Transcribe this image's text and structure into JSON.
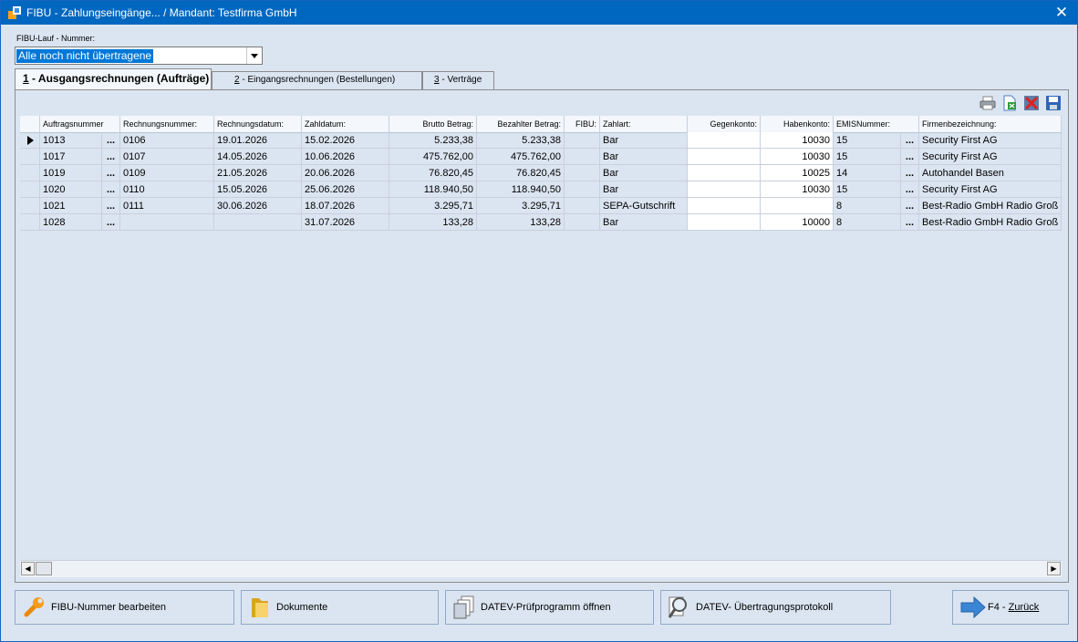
{
  "window": {
    "title": "FIBU - Zahlungseingänge... / Mandant: Testfirma GmbH",
    "close": "✕"
  },
  "fibu_lauf": {
    "label": "FIBU-Lauf - Nummer:",
    "selected": "Alle noch nicht übertragene"
  },
  "tabs": [
    {
      "num": "1",
      "label": " - Ausgangsrechnungen (Aufträge)"
    },
    {
      "num": "2",
      "label": " - Eingangsrechnungen (Bestellungen)"
    },
    {
      "num": "3",
      "label": " - Verträge"
    }
  ],
  "grid": {
    "headers": [
      "Auftragsnummer",
      "Rechnungsnummer:",
      "Rechnungsdatum:",
      "Zahldatum:",
      "Brutto Betrag:",
      "Bezahlter Betrag:",
      "FIBU:",
      "Zahlart:",
      "Gegenkonto:",
      "Habenkonto:",
      "EMISNummer:",
      "Firmenbezeichnung:"
    ],
    "dots": "...",
    "rows": [
      {
        "auftrag": "1013",
        "rechnung": "0106",
        "rdatum": "19.01.2026",
        "zdatum": "15.02.2026",
        "brutto": "5.233,38",
        "bezahlt": "5.233,38",
        "fibu": "",
        "zahlart": "Bar",
        "gegen": "",
        "haben": "10030",
        "emis": "15",
        "firma": "Security First AG"
      },
      {
        "auftrag": "1017",
        "rechnung": "0107",
        "rdatum": "14.05.2026",
        "zdatum": "10.06.2026",
        "brutto": "475.762,00",
        "bezahlt": "475.762,00",
        "fibu": "",
        "zahlart": "Bar",
        "gegen": "",
        "haben": "10030",
        "emis": "15",
        "firma": "Security First AG"
      },
      {
        "auftrag": "1019",
        "rechnung": "0109",
        "rdatum": "21.05.2026",
        "zdatum": "20.06.2026",
        "brutto": "76.820,45",
        "bezahlt": "76.820,45",
        "fibu": "",
        "zahlart": "Bar",
        "gegen": "",
        "haben": "10025",
        "emis": "14",
        "firma": "Autohandel Basen"
      },
      {
        "auftrag": "1020",
        "rechnung": "0110",
        "rdatum": "15.05.2026",
        "zdatum": "25.06.2026",
        "brutto": "118.940,50",
        "bezahlt": "118.940,50",
        "fibu": "",
        "zahlart": "Bar",
        "gegen": "",
        "haben": "10030",
        "emis": "15",
        "firma": "Security First AG"
      },
      {
        "auftrag": "1021",
        "rechnung": "0111",
        "rdatum": "30.06.2026",
        "zdatum": "18.07.2026",
        "brutto": "3.295,71",
        "bezahlt": "3.295,71",
        "fibu": "",
        "zahlart": "SEPA-Gutschrift",
        "gegen": "",
        "haben": "",
        "emis": "8",
        "firma": "Best-Radio GmbH Radio Groß"
      },
      {
        "auftrag": "1028",
        "rechnung": "",
        "rdatum": "",
        "zdatum": "31.07.2026",
        "brutto": "133,28",
        "bezahlt": "133,28",
        "fibu": "",
        "zahlart": "Bar",
        "gegen": "",
        "haben": "10000",
        "emis": "8",
        "firma": "Best-Radio GmbH Radio Groß"
      }
    ]
  },
  "buttons": {
    "fibu_nummer": "FIBU-Nummer bearbeiten",
    "dokumente": "Dokumente",
    "datev_pruef": "DATEV-Prüfprogramm öffnen",
    "datev_protokoll": "DATEV- Übertragungsprotokoll",
    "zurueck_prefix": "F4 - ",
    "zurueck_label": "Zurück"
  }
}
